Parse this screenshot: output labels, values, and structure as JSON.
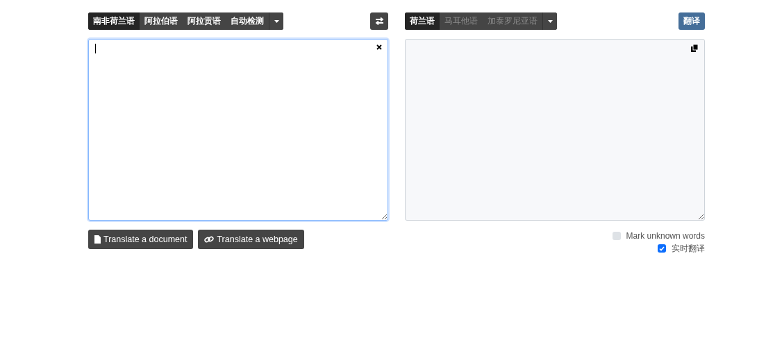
{
  "source": {
    "languages": [
      {
        "label": "南非荷兰语",
        "selected": true
      },
      {
        "label": "阿拉伯语",
        "selected": false
      },
      {
        "label": "阿拉贡语",
        "selected": false
      },
      {
        "label": "自动检测",
        "selected": false
      }
    ]
  },
  "target": {
    "languages": [
      {
        "label": "荷兰语",
        "selected": true
      },
      {
        "label": "马耳他语",
        "selected": false
      },
      {
        "label": "加泰罗尼亚语",
        "selected": false
      }
    ],
    "translate_button": "翻译"
  },
  "actions": [
    {
      "label": "Translate a document",
      "kind": "document"
    },
    {
      "label": "Translate a webpage",
      "kind": "link"
    }
  ],
  "options": [
    {
      "label": "Mark unknown words",
      "checked": false
    },
    {
      "label": "实时翻译",
      "checked": true
    }
  ]
}
